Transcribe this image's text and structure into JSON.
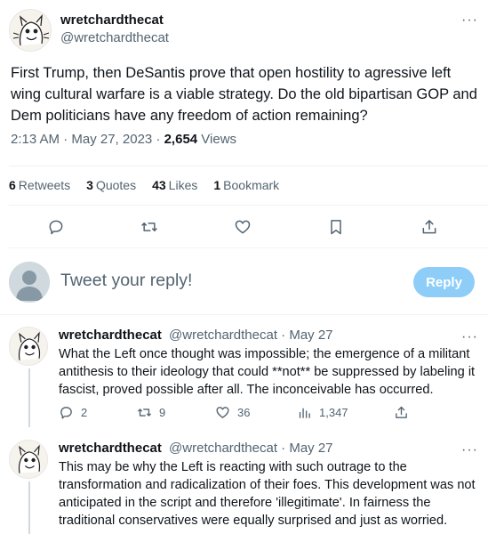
{
  "tweet": {
    "author_name": "wretchardthecat",
    "author_handle": "@wretchardthecat",
    "text": "First Trump, then DeSantis prove that open hostility to agressive left wing cultural warfare is a viable strategy. Do the old bipartisan GOP and Dem politicians have any freedom of action remaining?",
    "time": "2:13 AM · May 27, 2023 · ",
    "views_count": "2,654",
    "views_label": " Views",
    "stats": {
      "retweets_count": "6",
      "retweets_label": "Retweets",
      "quotes_count": "3",
      "quotes_label": "Quotes",
      "likes_count": "43",
      "likes_label": "Likes",
      "bookmarks_count": "1",
      "bookmarks_label": "Bookmark"
    }
  },
  "composer": {
    "placeholder": "Tweet your reply!",
    "reply_button": "Reply"
  },
  "replies": [
    {
      "author_name": "wretchardthecat",
      "author_handle": "@wretchardthecat",
      "date": "· May 27",
      "text": "What the Left once thought was impossible; the emergence of a militant antithesis to their ideology that could **not** be suppressed by labeling it fascist, proved possible after all. The inconceivable has occurred.",
      "replies_count": "2",
      "retweets_count": "9",
      "likes_count": "36",
      "views_count": "1,347"
    },
    {
      "author_name": "wretchardthecat",
      "author_handle": "@wretchardthecat",
      "date": "· May 27",
      "text": "This may be why the Left is reacting with such outrage to the transformation and radicalization of their foes. This development was not anticipated in the script and therefore 'illegitimate'. In fairness the traditional conservatives were equally surprised and just as worried."
    }
  ],
  "more_label": "···"
}
